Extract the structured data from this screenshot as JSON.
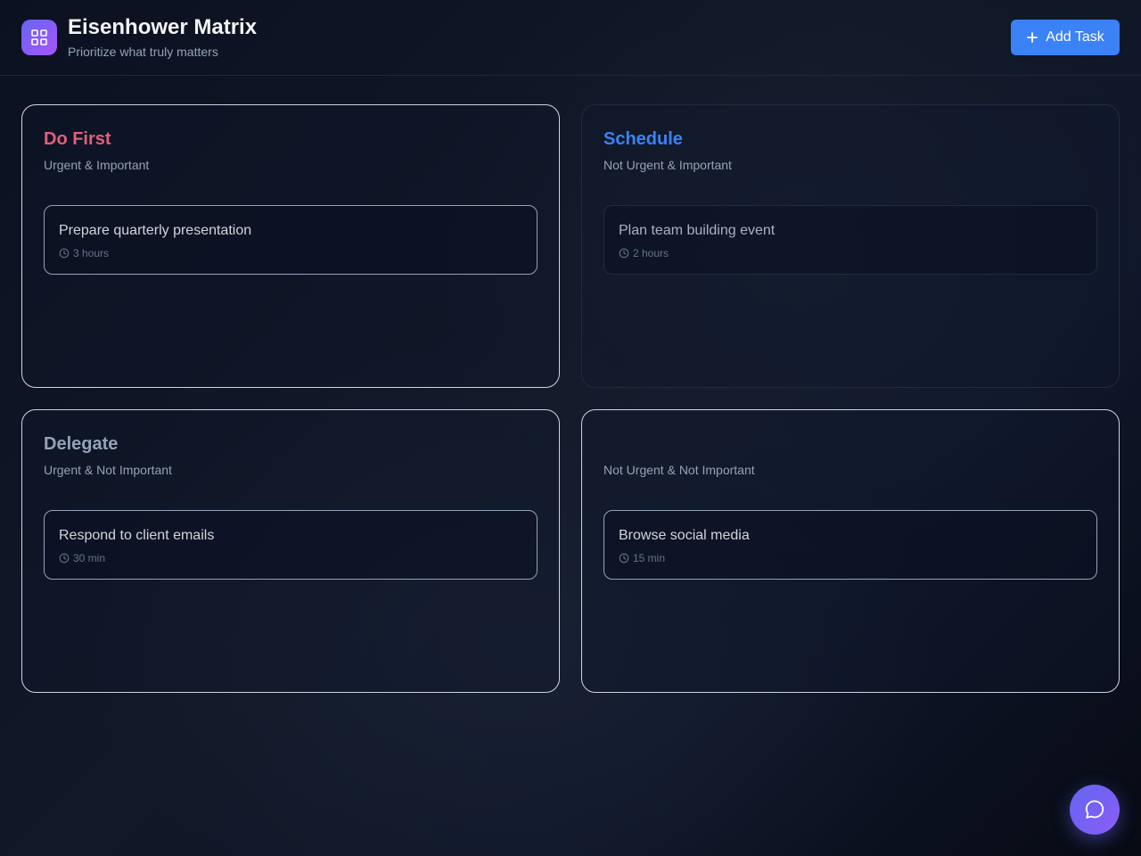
{
  "header": {
    "logo_icon": "grid-icon",
    "title": "Eisenhower Matrix",
    "subtitle": "Prioritize what truly matters",
    "add_button_icon": "plus-icon",
    "add_button_label": "Add Task"
  },
  "quadrants": [
    {
      "title": "Do First",
      "title_color": "#e0607a",
      "subtitle": "Urgent & Important",
      "tasks": [
        {
          "name": "Prepare quarterly presentation",
          "duration": "3 hours"
        }
      ]
    },
    {
      "title": "Schedule",
      "title_color": "#3b82f6",
      "subtitle": "Not Urgent & Important",
      "tasks": [
        {
          "name": "Plan team building event",
          "duration": "2 hours"
        }
      ]
    },
    {
      "title": "Delegate",
      "title_color": "#94a3b8",
      "subtitle": "Urgent & Not Important",
      "tasks": [
        {
          "name": "Respond to client emails",
          "duration": "30 min"
        }
      ]
    },
    {
      "title": "",
      "title_color": "#94a3b8",
      "subtitle": "Not Urgent & Not Important",
      "tasks": [
        {
          "name": "Browse social media",
          "duration": "15 min"
        }
      ]
    }
  ],
  "chat_button_icon": "chat-bubble-icon",
  "colors": {
    "accent": "#3b82f6",
    "brand_gradient_start": "#6366f1",
    "brand_gradient_end": "#8b5cf6"
  }
}
